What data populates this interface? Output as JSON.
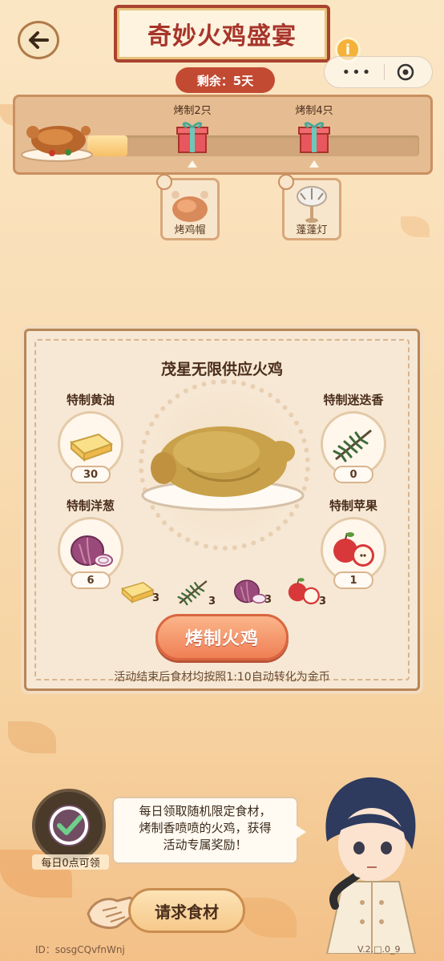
{
  "header": {
    "title": "奇妙火鸡盛宴",
    "remaining": "剩余：5天",
    "info_glyph": "i"
  },
  "progress": {
    "fill_fraction": 0.12,
    "milestones": [
      {
        "label": "烤制2只",
        "icon": "gift-icon"
      },
      {
        "label": "烤制4只",
        "icon": "gift-icon"
      }
    ],
    "rewards": [
      {
        "label": "烤鸡帽",
        "icon": "roast-chicken-hat-icon"
      },
      {
        "label": "蓬蓬灯",
        "icon": "fluffy-lamp-icon"
      }
    ]
  },
  "main": {
    "title": "茂星无限供应火鸡",
    "ingredients": [
      {
        "name": "特制黄油",
        "count": "30",
        "icon": "butter-icon"
      },
      {
        "name": "特制迷迭香",
        "count": "0",
        "icon": "rosemary-icon"
      },
      {
        "name": "特制洋葱",
        "count": "6",
        "icon": "onion-icon"
      },
      {
        "name": "特制苹果",
        "count": "1",
        "icon": "apple-icon"
      }
    ],
    "cost": [
      {
        "icon": "butter-icon",
        "count": "3"
      },
      {
        "icon": "rosemary-icon",
        "count": "3"
      },
      {
        "icon": "onion-icon",
        "count": "3"
      },
      {
        "icon": "apple-icon",
        "count": "3"
      }
    ],
    "roast_button": "烤制火鸡",
    "convert_note": "活动结束后食材均按照1:10自动转化为金币"
  },
  "bottom": {
    "daily_label": "每日0点可领",
    "speech": [
      "每日领取随机限定食材，",
      "烤制香喷喷的火鸡，获得",
      "活动专属奖励！"
    ],
    "request_button": "请求食材",
    "id_text": "ID：sosgCQvfnWnj",
    "version_text": "V.2.□.0_9"
  },
  "colors": {
    "accent_red": "#a8342a",
    "button_orange": "#f07f55",
    "panel_border": "#b88657"
  }
}
